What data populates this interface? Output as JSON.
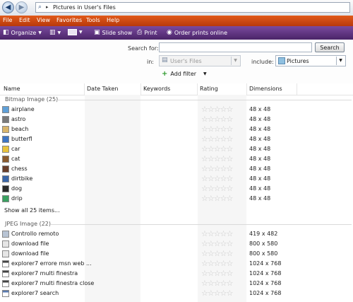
{
  "address": {
    "path": "Pictures in User's Files"
  },
  "menu": [
    "File",
    "Edit",
    "View",
    "Favorites",
    "Tools",
    "Help"
  ],
  "toolbar": {
    "organize": "Organize",
    "slideshow": "Slide show",
    "print": "Print",
    "order_prints": "Order prints online"
  },
  "search": {
    "search_for_label": "Search for:",
    "search_button": "Search",
    "in_label": "in:",
    "in_value": "User's Files",
    "include_label": "include:",
    "include_value": "Pictures",
    "add_filter": "Add filter"
  },
  "columns": [
    "Name",
    "Date Taken",
    "Keywords",
    "Rating",
    "Dimensions"
  ],
  "groups": [
    {
      "title": "Bitmap Image (25)",
      "items": [
        {
          "name": "airplane",
          "dims": "48 x 48"
        },
        {
          "name": "astro",
          "dims": "48 x 48"
        },
        {
          "name": "beach",
          "dims": "48 x 48"
        },
        {
          "name": "butterfl",
          "dims": "48 x 48"
        },
        {
          "name": "car",
          "dims": "48 x 48"
        },
        {
          "name": "cat",
          "dims": "48 x 48"
        },
        {
          "name": "chess",
          "dims": "48 x 48"
        },
        {
          "name": "dirtbike",
          "dims": "48 x 48"
        },
        {
          "name": "dog",
          "dims": "48 x 48"
        },
        {
          "name": "drip",
          "dims": "48 x 48"
        }
      ],
      "show_all": "Show all 25 items..."
    },
    {
      "title": "JPEG Image (22)",
      "items": [
        {
          "name": "Controllo remoto",
          "dims": "419 x 482"
        },
        {
          "name": "download file",
          "dims": "800 x 580"
        },
        {
          "name": "download file",
          "dims": "800 x 580"
        },
        {
          "name": "explorer7 errore msn web ...",
          "dims": "1024 x 768"
        },
        {
          "name": "explorer7 multi finestra",
          "dims": "1024 x 768"
        },
        {
          "name": "explorer7 multi finestra close",
          "dims": "1024 x 768"
        },
        {
          "name": "explorer7 search",
          "dims": "1024 x 768"
        }
      ]
    }
  ],
  "rating_stars": "☆☆☆☆☆",
  "colors": {
    "menubar": "#c8460f",
    "toolbar": "#5d3380",
    "accent": "#1d3e6b"
  }
}
